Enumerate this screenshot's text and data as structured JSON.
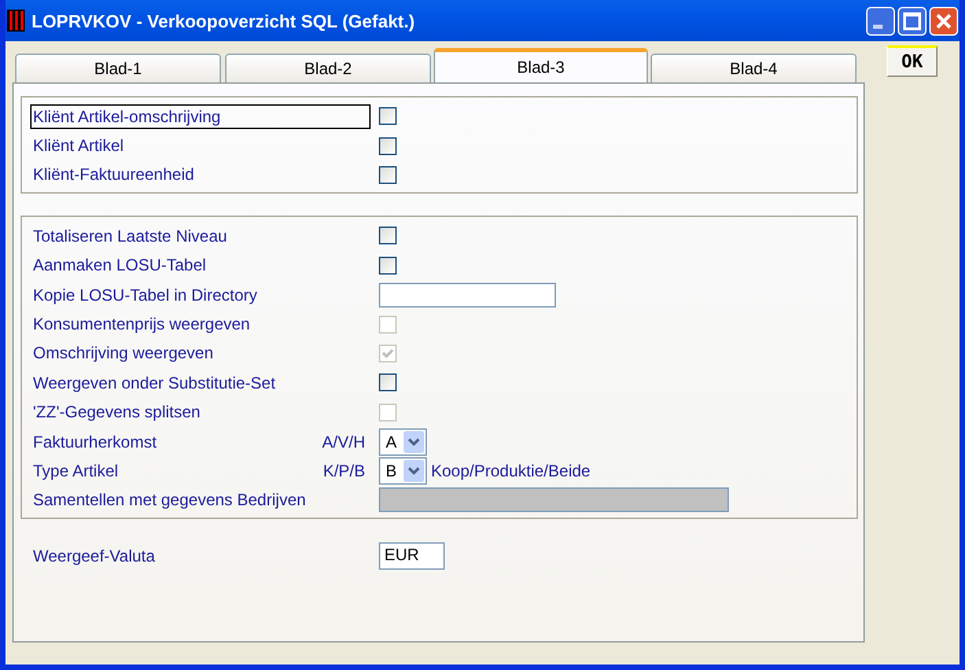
{
  "window": {
    "title": "LOPRVKOV - Verkoopoverzicht SQL (Gefakt.)"
  },
  "tabs": [
    {
      "label": "Blad-1",
      "selected": false
    },
    {
      "label": "Blad-2",
      "selected": false
    },
    {
      "label": "Blad-3",
      "selected": true
    },
    {
      "label": "Blad-4",
      "selected": false
    }
  ],
  "ok_button": "OK",
  "groups": [
    {
      "rows": [
        {
          "kind": "checkbox",
          "label": "Kliënt Artikel-omschrijving",
          "focused": true,
          "checked": false,
          "disabled": false
        },
        {
          "kind": "checkbox",
          "label": "Kliënt Artikel",
          "focused": false,
          "checked": false,
          "disabled": false
        },
        {
          "kind": "checkbox",
          "label": "Kliënt-Faktuureenheid",
          "focused": false,
          "checked": false,
          "disabled": false
        }
      ]
    },
    {
      "rows": [
        {
          "kind": "checkbox",
          "label": "Totaliseren Laatste Niveau",
          "checked": false,
          "disabled": false
        },
        {
          "kind": "checkbox",
          "label": "Aanmaken LOSU-Tabel",
          "checked": false,
          "disabled": false
        },
        {
          "kind": "text",
          "label": "Kopie LOSU-Tabel in Directory",
          "disabled": false
        },
        {
          "kind": "checkbox",
          "label": "Konsumentenprijs weergeven",
          "checked": false,
          "disabled": true
        },
        {
          "kind": "checkbox",
          "label": "Omschrijving weergeven",
          "checked": true,
          "disabled": true
        },
        {
          "kind": "checkbox",
          "label": "Weergeven onder Substitutie-Set",
          "checked": false,
          "disabled": false
        },
        {
          "kind": "checkbox",
          "label": "'ZZ'-Gegevens splitsen",
          "checked": false,
          "disabled": true
        },
        {
          "kind": "select",
          "label": "Faktuurherkomst",
          "hint": "A/V/H",
          "value": "A"
        },
        {
          "kind": "select",
          "label": "Type Artikel",
          "hint": "K/P/B",
          "value": "B",
          "suffix": "Koop/Produktie/Beide"
        },
        {
          "kind": "text",
          "label": "Samentellen met gegevens Bedrijven",
          "disabled": true
        }
      ]
    }
  ],
  "valuta": {
    "label": "Weergeef-Valuta",
    "value": "EUR"
  }
}
